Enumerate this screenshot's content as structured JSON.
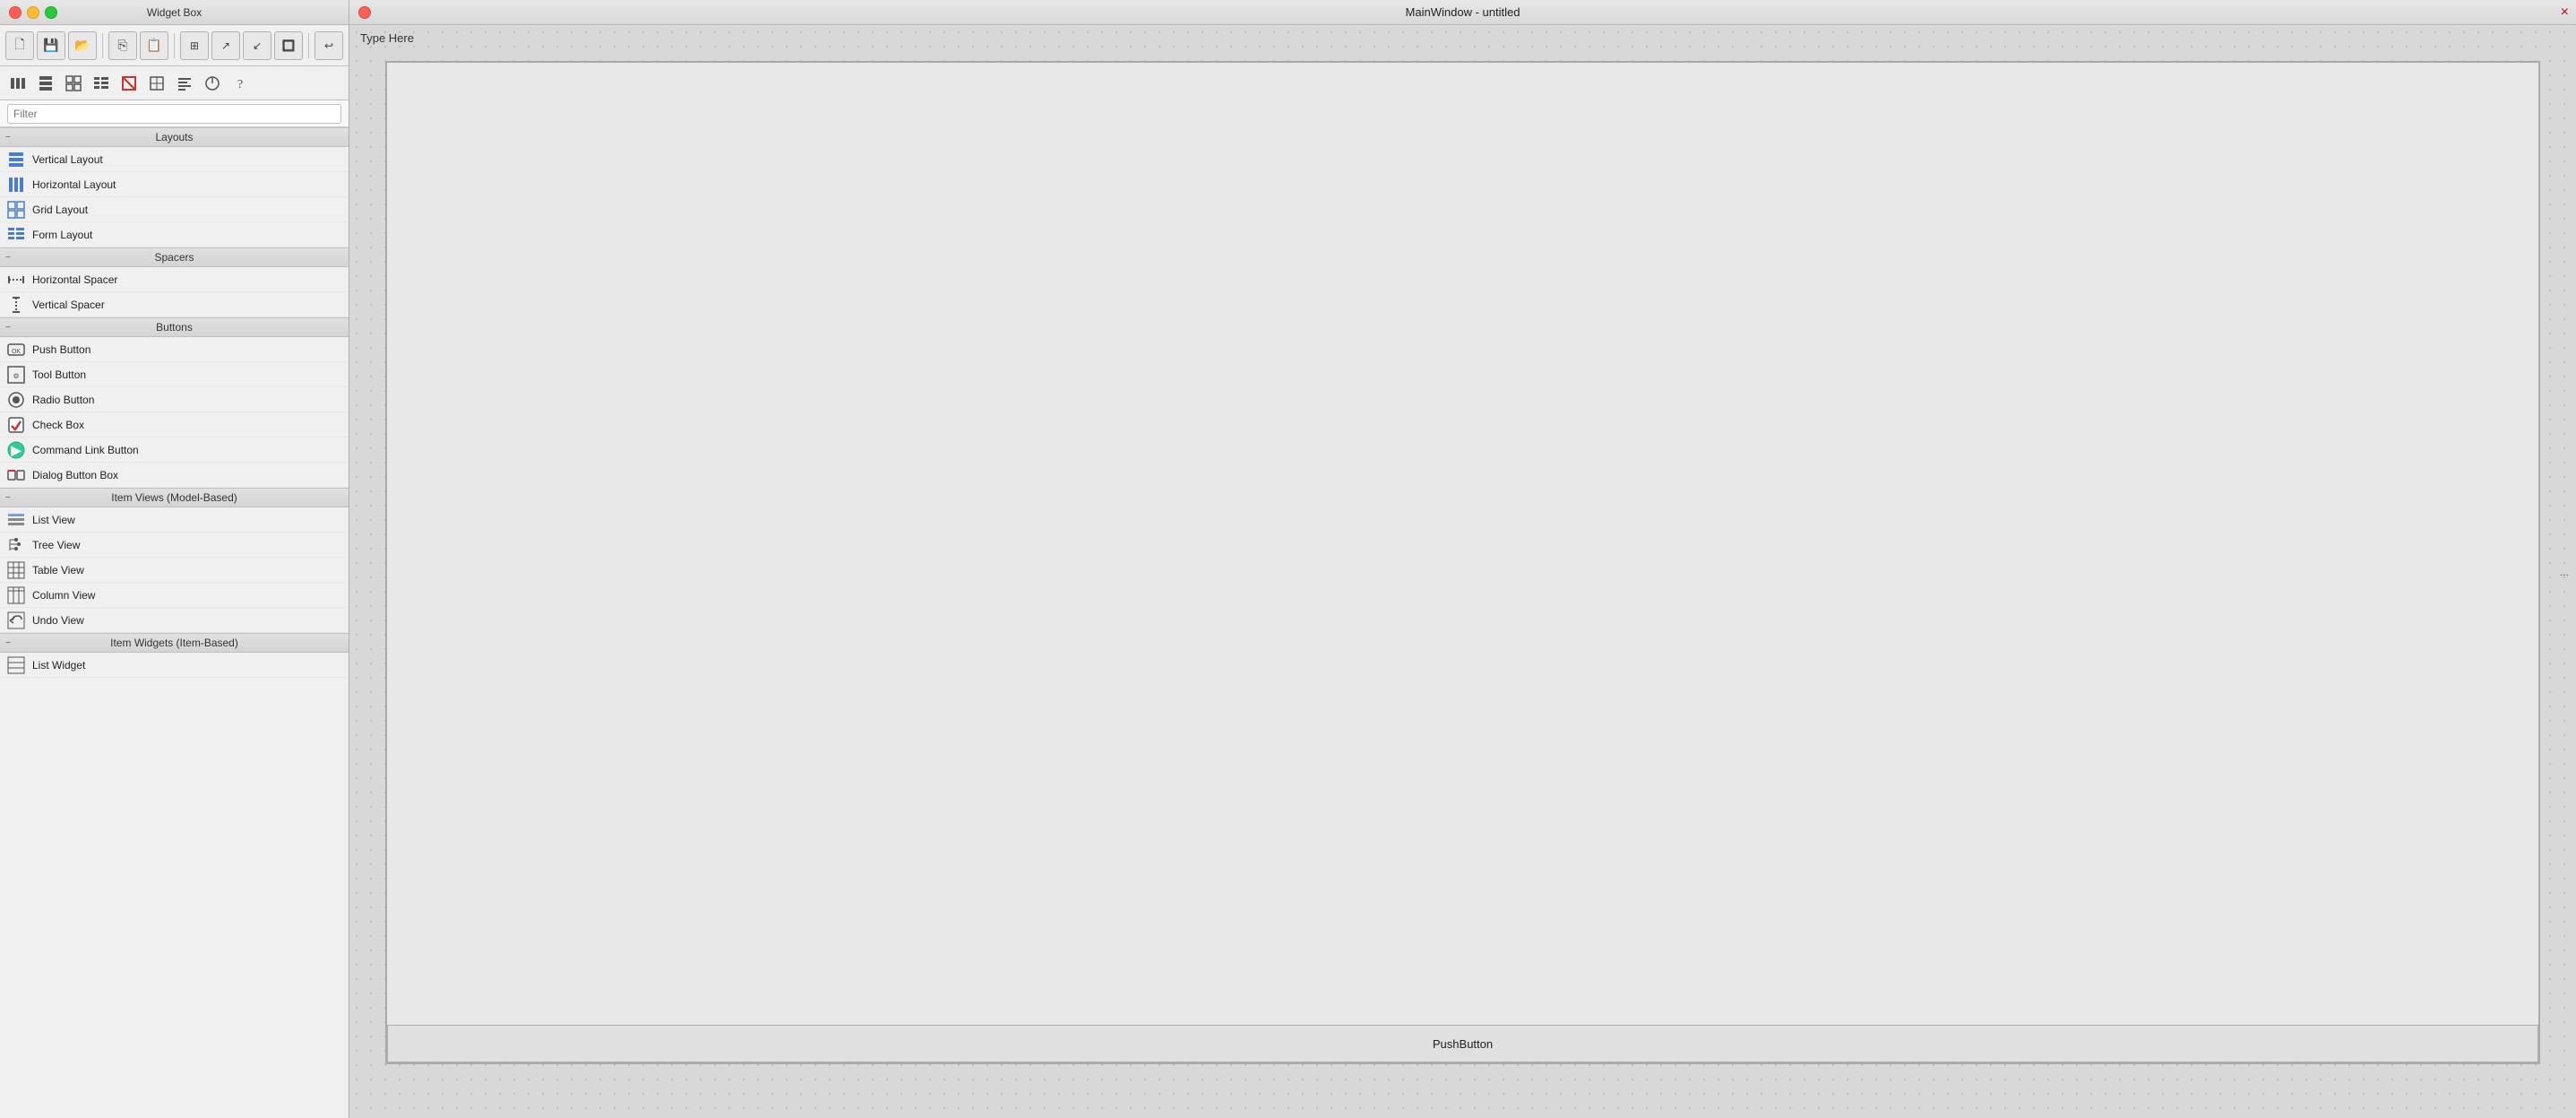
{
  "widget_box": {
    "title": "Widget Box",
    "filter_placeholder": "Filter",
    "sections": [
      {
        "id": "layouts",
        "label": "Layouts",
        "items": [
          {
            "id": "vertical-layout",
            "label": "Vertical Layout",
            "icon": "vl"
          },
          {
            "id": "horizontal-layout",
            "label": "Horizontal Layout",
            "icon": "hl"
          },
          {
            "id": "grid-layout",
            "label": "Grid Layout",
            "icon": "grid"
          },
          {
            "id": "form-layout",
            "label": "Form Layout",
            "icon": "form"
          }
        ]
      },
      {
        "id": "spacers",
        "label": "Spacers",
        "items": [
          {
            "id": "horizontal-spacer",
            "label": "Horizontal Spacer",
            "icon": "hspacer"
          },
          {
            "id": "vertical-spacer",
            "label": "Vertical Spacer",
            "icon": "vspacer"
          }
        ]
      },
      {
        "id": "buttons",
        "label": "Buttons",
        "items": [
          {
            "id": "push-button",
            "label": "Push Button",
            "icon": "pushbtn"
          },
          {
            "id": "tool-button",
            "label": "Tool Button",
            "icon": "toolbtn"
          },
          {
            "id": "radio-button",
            "label": "Radio Button",
            "icon": "radio"
          },
          {
            "id": "check-box",
            "label": "Check Box",
            "icon": "checkbox"
          },
          {
            "id": "command-link-button",
            "label": "Command Link Button",
            "icon": "cmdlink"
          },
          {
            "id": "dialog-button-box",
            "label": "Dialog Button Box",
            "icon": "dialogbtn"
          }
        ]
      },
      {
        "id": "item-views",
        "label": "Item Views (Model-Based)",
        "items": [
          {
            "id": "list-view",
            "label": "List View",
            "icon": "listview"
          },
          {
            "id": "tree-view",
            "label": "Tree View",
            "icon": "treeview"
          },
          {
            "id": "table-view",
            "label": "Table View",
            "icon": "tableview"
          },
          {
            "id": "column-view",
            "label": "Column View",
            "icon": "columnview"
          },
          {
            "id": "undo-view",
            "label": "Undo View",
            "icon": "undoview"
          }
        ]
      },
      {
        "id": "item-widgets",
        "label": "Item Widgets (Item-Based)",
        "items": [
          {
            "id": "list-widget",
            "label": "List Widget",
            "icon": "listwidget"
          }
        ]
      }
    ]
  },
  "toolbar": {
    "buttons": [
      "🗋",
      "💾",
      "📁",
      "⎘",
      "▭",
      "⊞",
      "↗",
      "↙",
      "🔲",
      "↩"
    ]
  },
  "toolbar2": {
    "buttons": [
      "▤",
      "☰",
      "⊟",
      "⊞",
      "⊠",
      "⊡",
      "◉",
      "⊘",
      "?"
    ]
  },
  "main_window": {
    "title": "MainWindow - untitled",
    "menu_items": [
      "Type Here"
    ],
    "push_button_label": "PushButton",
    "ellipsis_label": "...",
    "close_marker": "×"
  }
}
